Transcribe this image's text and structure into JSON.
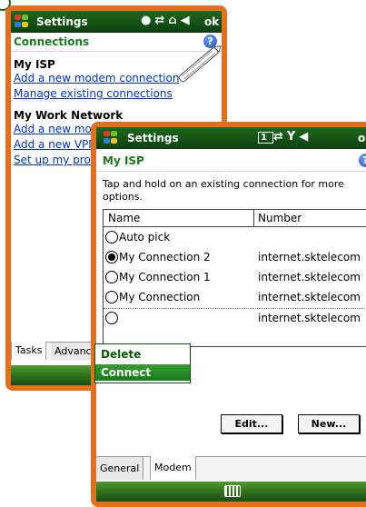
{
  "back_window": {
    "title": "Settings",
    "tray_icons": [
      "status-dot-icon",
      "sync-icon",
      "signal-icon",
      "volume-icon"
    ],
    "ok_label": "ok",
    "header": "Connections",
    "help": "?",
    "section1": "My ISP",
    "links1": [
      "Add a new modem connection",
      "Manage existing connections"
    ],
    "section2": "My Work Network",
    "links2": [
      "Add a new modem connection",
      "Add a new VPN server connection",
      "Set up my proxy server"
    ],
    "tabs": [
      "Tasks",
      "Advanced"
    ]
  },
  "front_window": {
    "title": "Settings",
    "tray_icons": [
      "sim-icon",
      "sync-icon",
      "antenna-icon",
      "volume-icon"
    ],
    "ok_label": "ok",
    "header": "My ISP",
    "help": "?",
    "instruction": "Tap and hold on an existing connection for more options.",
    "columns": [
      "Name",
      "Number"
    ],
    "rows": [
      {
        "name": "Auto pick",
        "number": "",
        "selected": false
      },
      {
        "name": "My Connection 2",
        "number": "internet.sktelecom",
        "selected": true
      },
      {
        "name": "My Connection 1",
        "number": "internet.sktelecom",
        "selected": false
      },
      {
        "name": "My Connection",
        "number": "internet.sktelecom",
        "selected": false
      },
      {
        "name": "",
        "number": "internet.sktelecom",
        "selected": false
      }
    ],
    "buttons": {
      "edit": "Edit...",
      "new": "New..."
    },
    "tabs": [
      "General",
      "Modem"
    ]
  },
  "context_menu": {
    "items": [
      "Delete",
      "Connect"
    ],
    "selected": "Connect"
  }
}
